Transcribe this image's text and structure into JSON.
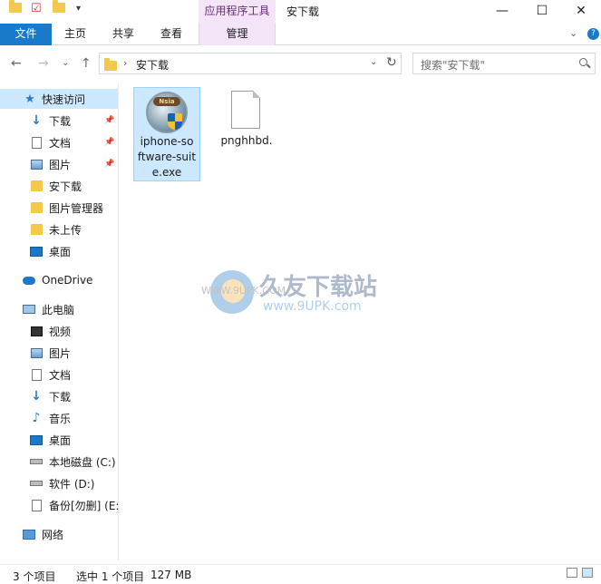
{
  "window": {
    "contextual_tab": "应用程序工具",
    "title": "安下载",
    "minimize": "—",
    "maximize": "☐",
    "close": "✕"
  },
  "ribbon": {
    "file_tab": "文件",
    "tabs": [
      "主页",
      "共享",
      "查看"
    ],
    "contextual_tab": "管理",
    "collapse": "⌄",
    "help": "?"
  },
  "address": {
    "crumb": "安下载",
    "separator": "›",
    "dropdown": "⌄",
    "refresh": "↻"
  },
  "search": {
    "placeholder": "搜索\"安下载\""
  },
  "nav": {
    "back": "←",
    "forward": "→",
    "recent": "⌄",
    "up": "↑"
  },
  "sidebar": {
    "quick_access": "快速访问",
    "quick_items": [
      {
        "label": "下载",
        "pinned": true
      },
      {
        "label": "文档",
        "pinned": true
      },
      {
        "label": "图片",
        "pinned": true
      },
      {
        "label": "安下载",
        "pinned": false
      },
      {
        "label": "图片管理器",
        "pinned": false
      },
      {
        "label": "未上传",
        "pinned": false
      },
      {
        "label": "桌面",
        "pinned": false
      }
    ],
    "onedrive": "OneDrive",
    "this_pc": "此电脑",
    "pc_items": [
      "视频",
      "图片",
      "文档",
      "下载",
      "音乐",
      "桌面",
      "本地磁盘 (C:)",
      "软件 (D:)",
      "备份[勿删] (E:"
    ],
    "network": "网络"
  },
  "files": [
    {
      "name": "iphone-software-suite.exe",
      "lines": [
        "iphone-so",
        "ftware-suit",
        "e.exe"
      ],
      "badge": "Nsia",
      "selected": true
    },
    {
      "name": "pnghhbd.",
      "lines": [
        "pnghhbd."
      ],
      "selected": false
    }
  ],
  "watermark": {
    "brand": "久友下载站",
    "url": "www.9UPK.com",
    "url_small": "WWW.9UPK.COM"
  },
  "status": {
    "count": "3 个项目",
    "selected": "选中 1 个项目",
    "size": "127 MB"
  },
  "colors": {
    "accent": "#1979ca",
    "selection": "#cce8ff",
    "contextual": "#f4e4f7"
  }
}
